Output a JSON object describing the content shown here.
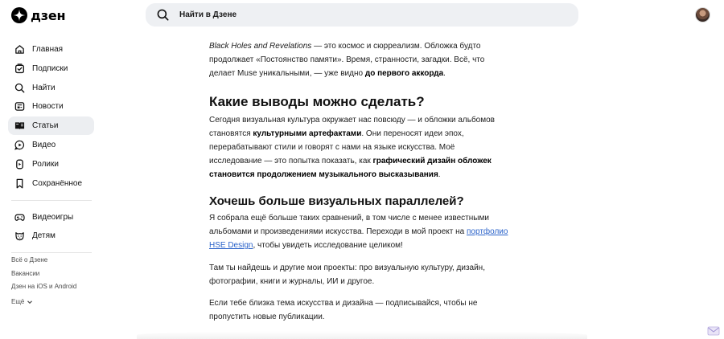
{
  "header": {
    "logo_text": "дзен",
    "search_placeholder": "Найти в Дзене"
  },
  "sidebar": {
    "items": [
      {
        "label": "Главная",
        "icon": "home-icon",
        "active": false
      },
      {
        "label": "Подписки",
        "icon": "subscriptions-icon",
        "active": false
      },
      {
        "label": "Найти",
        "icon": "search-icon",
        "active": false
      },
      {
        "label": "Новости",
        "icon": "news-icon",
        "active": false
      },
      {
        "label": "Статьи",
        "icon": "articles-icon",
        "active": true
      },
      {
        "label": "Видео",
        "icon": "video-icon",
        "active": false
      },
      {
        "label": "Ролики",
        "icon": "shorts-icon",
        "active": false
      },
      {
        "label": "Сохранённое",
        "icon": "bookmark-icon",
        "active": false
      }
    ],
    "items2": [
      {
        "label": "Видеоигры",
        "icon": "gamepad-icon"
      },
      {
        "label": "Детям",
        "icon": "kids-icon"
      }
    ],
    "footer": [
      "Всё о Дзене",
      "Вакансии",
      "Дзен на iOS и Android",
      "Ещё"
    ]
  },
  "article": {
    "p1": {
      "italic": "Black Holes and Revelations",
      "text1": " — это космос и сюрреализм. Обложка будто продолжает «Постоянство памяти». Время, странности, загадки. Всё, что делает Muse уникальными, — уже видно ",
      "bold": "до первого аккорда",
      "text2": "."
    },
    "h2": "Какие выводы можно сделать?",
    "p2": {
      "text1": "Сегодня визуальная культура окружает нас повсюду — и обложки альбомов становятся ",
      "bold1": "культурными артефактами",
      "text2": ". Они переносят идеи эпох, перерабатывают стили и говорят с нами на языке искусства. Моё исследование — это попытка показать, как ",
      "bold2": "графический дизайн обложек становится продолжением музыкального высказывания",
      "text3": "."
    },
    "h3": "Хочешь больше визуальных параллелей?",
    "p3": {
      "text1": "Я собрала ещё больше таких сравнений, в том числе с менее известными альбомами и произведениями искусства. Переходи в мой проект на ",
      "link": "портфолио HSE Design",
      "text2": ", чтобы увидеть исследование целиком!"
    },
    "p4": "Там ты найдешь и другие мои проекты: про визуальную культуру, дизайн, фотографии, книги и журналы, ИИ и другое.",
    "p5": "Если тебе близка тема искусства и дизайна — подписывайся, чтобы не пропустить новые публикации."
  }
}
